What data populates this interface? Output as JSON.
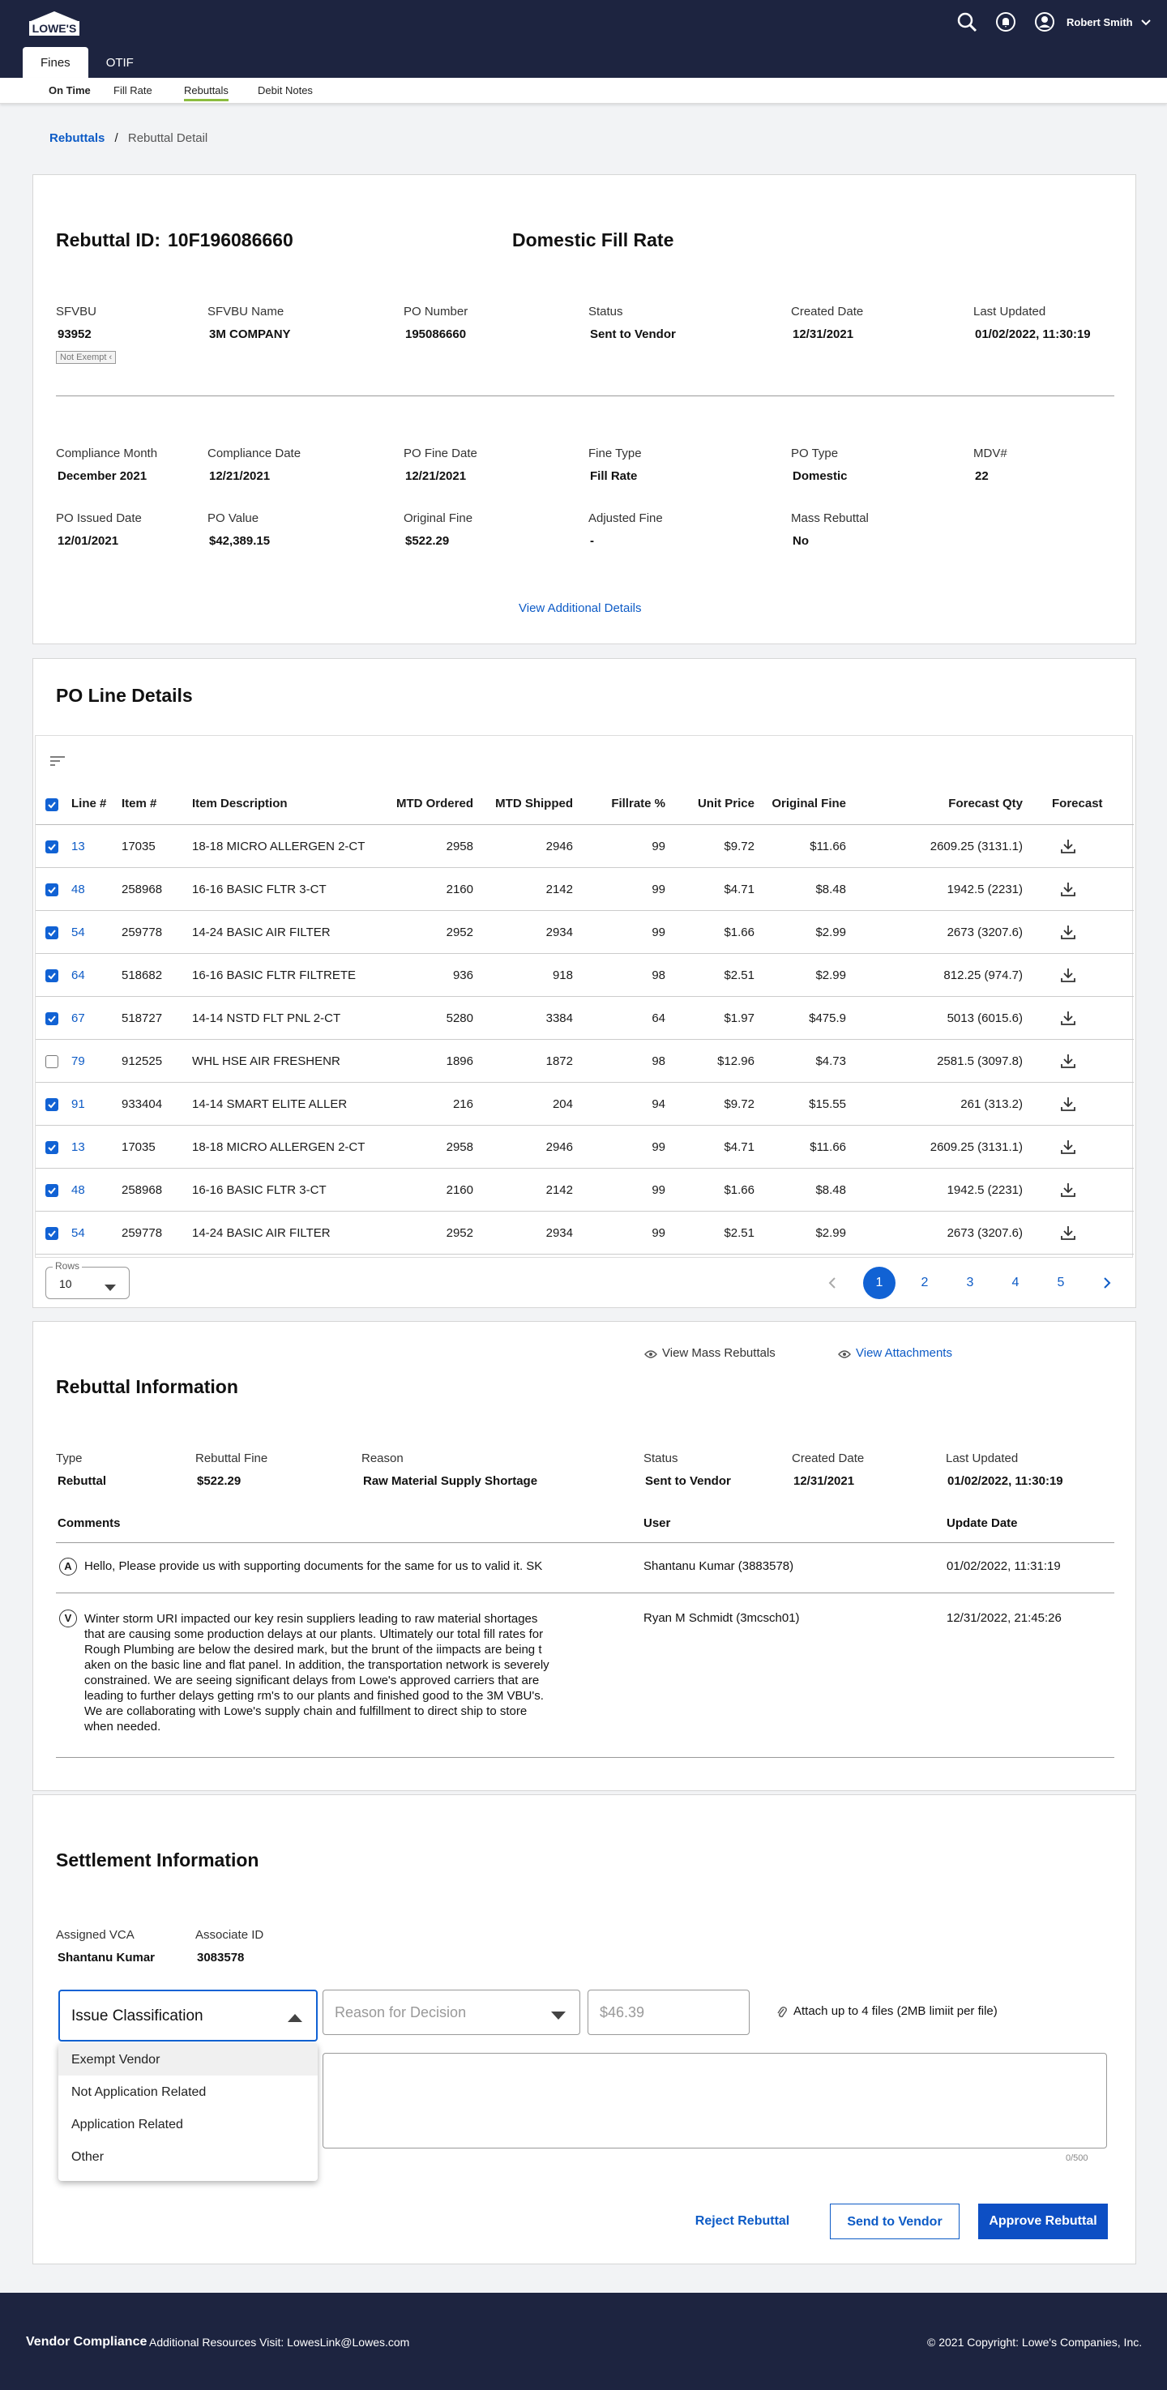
{
  "header": {
    "logo_text": "LOWE'S",
    "user_name": "Robert Smith",
    "tabs": [
      "Fines",
      "OTIF"
    ],
    "subnav": [
      "On Time",
      "Fill Rate",
      "Rebuttals",
      "Debit Notes"
    ]
  },
  "breadcrumb": {
    "parent": "Rebuttals",
    "sep": "/",
    "current": "Rebuttal Detail"
  },
  "summary": {
    "id_label": "Rebuttal ID:",
    "id_value": "10F196086660",
    "type_title": "Domestic Fill Rate",
    "row1": [
      {
        "label": "SFVBU",
        "value": "93952"
      },
      {
        "label": "SFVBU Name",
        "value": "3M COMPANY"
      },
      {
        "label": "PO Number",
        "value": "195086660"
      },
      {
        "label": "Status",
        "value": "Sent to Vendor"
      },
      {
        "label": "Created Date",
        "value": "12/31/2021"
      },
      {
        "label": "Last Updated",
        "value": "01/02/2022, 11:30:19"
      }
    ],
    "exempt_badge": "Not Exempt",
    "row2": [
      {
        "label": "Compliance Month",
        "value": "December 2021"
      },
      {
        "label": "Compliance Date",
        "value": "12/21/2021"
      },
      {
        "label": "PO Fine Date",
        "value": "12/21/2021"
      },
      {
        "label": "Fine Type",
        "value": "Fill Rate"
      },
      {
        "label": "PO Type",
        "value": "Domestic"
      },
      {
        "label": "MDV#",
        "value": "22"
      }
    ],
    "row3": [
      {
        "label": "PO Issued Date",
        "value": "12/01/2021"
      },
      {
        "label": "PO Value",
        "value": "$42,389.15"
      },
      {
        "label": "Original Fine",
        "value": "$522.29"
      },
      {
        "label": "Adjusted Fine",
        "value": "-"
      },
      {
        "label": "Mass Rebuttal",
        "value": "No"
      }
    ],
    "view_more": "View Additional Details"
  },
  "po_lines": {
    "title": "PO Line Details",
    "columns": [
      "Line #",
      "Item #",
      "Item Description",
      "MTD Ordered",
      "MTD Shipped",
      "Fillrate %",
      "Unit Price",
      "Original Fine",
      "Forecast Qty",
      "Forecast"
    ],
    "rows": [
      {
        "checked": true,
        "cells": [
          "13",
          "17035",
          "18-18 MICRO ALLERGEN 2-CT",
          "2958",
          "2946",
          "99",
          "$9.72",
          "$11.66",
          "2609.25 (3131.1)"
        ]
      },
      {
        "checked": true,
        "cells": [
          "48",
          "258968",
          "16-16 BASIC FLTR 3-CT",
          "2160",
          "2142",
          "99",
          "$4.71",
          "$8.48",
          "1942.5 (2231)"
        ]
      },
      {
        "checked": true,
        "cells": [
          "54",
          "259778",
          "14-24 BASIC AIR FILTER",
          "2952",
          "2934",
          "99",
          "$1.66",
          "$2.99",
          "2673 (3207.6)"
        ]
      },
      {
        "checked": true,
        "cells": [
          "64",
          "518682",
          "16-16 BASIC FLTR FILTRETE",
          "936",
          "918",
          "98",
          "$2.51",
          "$2.99",
          "812.25 (974.7)"
        ]
      },
      {
        "checked": true,
        "cells": [
          "67",
          "518727",
          "14-14 NSTD FLT PNL 2-CT",
          "5280",
          "3384",
          "64",
          "$1.97",
          "$475.9",
          "5013 (6015.6)"
        ]
      },
      {
        "checked": false,
        "cells": [
          "79",
          "912525",
          "WHL HSE AIR FRESHENR",
          "1896",
          "1872",
          "98",
          "$12.96",
          "$4.73",
          "2581.5 (3097.8)"
        ]
      },
      {
        "checked": true,
        "cells": [
          "91",
          "933404",
          "14-14 SMART ELITE ALLER",
          "216",
          "204",
          "94",
          "$9.72",
          "$15.55",
          "261 (313.2)"
        ]
      },
      {
        "checked": true,
        "cells": [
          "13",
          "17035",
          "18-18 MICRO ALLERGEN 2-CT",
          "2958",
          "2946",
          "99",
          "$4.71",
          "$11.66",
          "2609.25 (3131.1)"
        ]
      },
      {
        "checked": true,
        "cells": [
          "48",
          "258968",
          "16-16 BASIC FLTR 3-CT",
          "2160",
          "2142",
          "99",
          "$1.66",
          "$8.48",
          "1942.5 (2231)"
        ]
      },
      {
        "checked": true,
        "cells": [
          "54",
          "259778",
          "14-24 BASIC AIR FILTER",
          "2952",
          "2934",
          "99",
          "$2.51",
          "$2.99",
          "2673 (3207.6)"
        ]
      }
    ],
    "rows_label": "Rows",
    "rows_value": "10",
    "pages": [
      "1",
      "2",
      "3",
      "4",
      "5"
    ]
  },
  "rebuttal": {
    "title": "Rebuttal Information",
    "mass_link": "View Mass Rebuttals",
    "attach_link": "View Attachments",
    "fields": [
      {
        "label": "Type",
        "value": "Rebuttal"
      },
      {
        "label": "Rebuttal Fine",
        "value": "$522.29"
      },
      {
        "label": "Reason",
        "value": "Raw Material Supply Shortage"
      },
      {
        "label": "Status",
        "value": "Sent to Vendor"
      },
      {
        "label": "Created Date",
        "value": "12/31/2021"
      },
      {
        "label": "Last Updated",
        "value": "01/02/2022, 11:30:19"
      }
    ],
    "comment_headers": [
      "Comments",
      "User",
      "Update Date"
    ],
    "comments": [
      {
        "avatar": "A",
        "lines": [
          "Hello, Please provide us with supporting documents for the same for us to valid it.  SK"
        ],
        "user": "Shantanu Kumar (3883578)",
        "date": "01/02/2022, 11:31:19"
      },
      {
        "avatar": "V",
        "lines": [
          "Winter storm URI impacted our key resin suppliers leading to raw material shortages",
          "that are causing some production delays at our plants.  Ultimately our total fill rates for",
          "Rough Plumbing are below the desired mark, but the brunt of the iimpacts are being t",
          "aken on the basic line and flat panel.  In addition, the transportation network is severely",
          "constrained.  We are seeing significant delays from Lowe's approved carriers that are",
          "leading to further delays getting rm's to our plants and finished good to the 3M VBU's.",
          "We are collaborating with Lowe's supply chain and fulfillment to direct ship to store",
          "when needed."
        ],
        "user": "Ryan M Schmidt (3mcsch01)",
        "date": "12/31/2022, 21:45:26"
      }
    ]
  },
  "settlement": {
    "title": "Settlement Information",
    "fields": [
      {
        "label": "Assigned VCA",
        "value": "Shantanu Kumar"
      },
      {
        "label": "Associate ID",
        "value": "3083578"
      }
    ],
    "issue_placeholder": "Issue Classification",
    "reason_placeholder": "Reason for Decision",
    "amount_placeholder": "$46.39",
    "attach_text": "Attach up to 4 files (2MB limiit per file)",
    "options": [
      "Exempt Vendor",
      "Not Application Related",
      "Application Related",
      "Other"
    ],
    "counter": "0/500",
    "buttons": {
      "reject": "Reject Rebuttal",
      "send": "Send to Vendor",
      "approve": "Approve Rebuttal"
    }
  },
  "footer": {
    "brand": "Vendor Compliance",
    "resources": "Additional Resources Visit: LowesLink@Lowes.com",
    "copyright": "© 2021 Copyright: Lowe's Companies, Inc."
  },
  "colors": {
    "navy": "#1d2440",
    "link": "#0d5bc6",
    "primary": "#1162d4",
    "accent": "#8bbc3f"
  }
}
